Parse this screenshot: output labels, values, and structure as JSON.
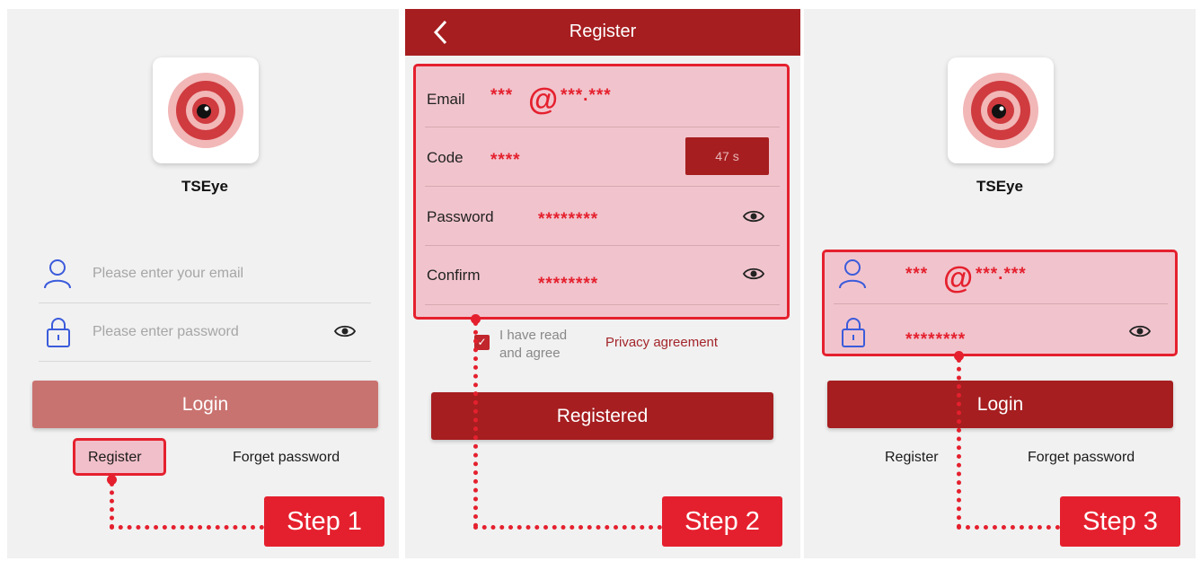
{
  "step1": {
    "app_name": "TSEye",
    "email_placeholder": "Please enter your email",
    "password_placeholder": "Please enter password",
    "login_label": "Login",
    "register_label": "Register",
    "forget_label": "Forget password",
    "step_label": "Step 1"
  },
  "step2": {
    "title": "Register",
    "email_label": "Email",
    "email_value_a": "***",
    "email_at": "@",
    "email_value_b": "***.***",
    "code_label": "Code",
    "code_value": "****",
    "countdown": "47 s",
    "password_label": "Password",
    "password_value": "********",
    "confirm_label": "Confirm",
    "confirm_value": "********",
    "agree_line1": "I have read",
    "agree_line2": "and agree",
    "privacy_label": "Privacy agreement",
    "submit_label": "Registered",
    "step_label": "Step 2"
  },
  "step3": {
    "app_name": "TSEye",
    "email_value_a": "***",
    "email_at": "@",
    "email_value_b": "***.***",
    "password_value": "********",
    "login_label": "Login",
    "register_label": "Register",
    "forget_label": "Forget password",
    "step_label": "Step 3"
  },
  "colors": {
    "brand_dark": "#a61e20",
    "login_disabled": "#c97370",
    "highlight_red": "#e5202e",
    "icon_blue": "#3b5bdb"
  }
}
